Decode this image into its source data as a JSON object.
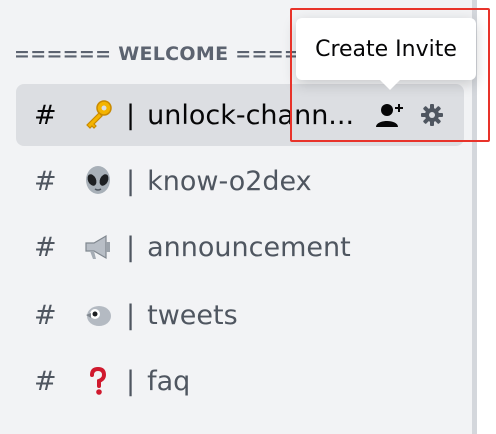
{
  "category": {
    "label": "====== WELCOME ======",
    "icon": "chevron-down-icon"
  },
  "channels": [
    {
      "prefix": "#",
      "emoji": "key-icon",
      "separator": "|",
      "name": "unlock-chann...",
      "active": true
    },
    {
      "prefix": "#",
      "emoji": "alien-icon",
      "separator": "|",
      "name": "know-o2dex",
      "active": false
    },
    {
      "prefix": "#",
      "emoji": "megaphone-icon",
      "separator": "|",
      "name": "announcement",
      "active": false
    },
    {
      "prefix": "#",
      "emoji": "bird-icon",
      "separator": "|",
      "name": "tweets",
      "active": false
    },
    {
      "prefix": "#",
      "emoji": "question-icon",
      "separator": "|",
      "name": "faq",
      "active": false
    }
  ],
  "tooltip": {
    "label": "Create Invite"
  },
  "active_actions": {
    "invite_icon": "add-user-icon",
    "settings_icon": "gear-icon"
  },
  "colors": {
    "background": "#f2f3f5",
    "active_bg": "#dcdee2",
    "highlight": "#e8332a"
  }
}
